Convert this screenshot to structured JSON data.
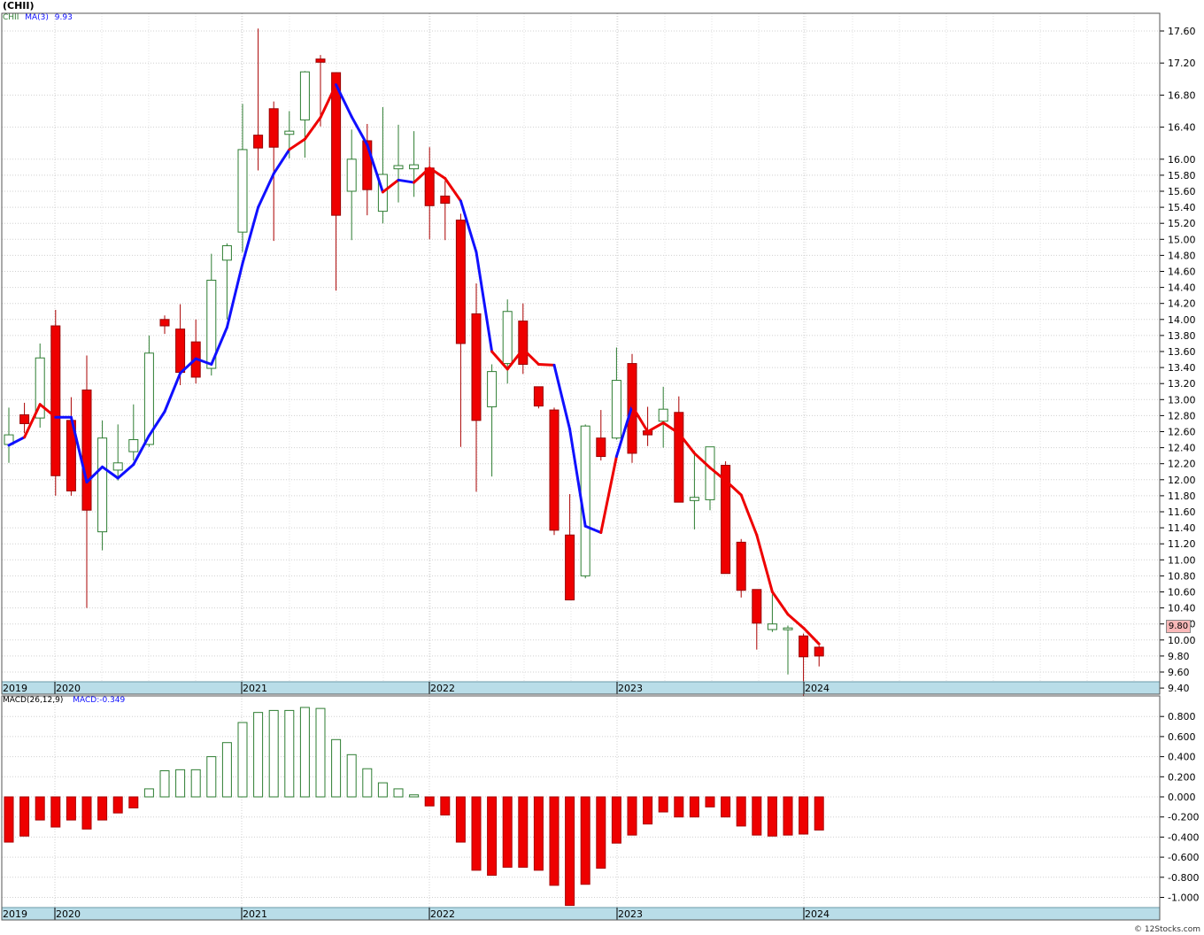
{
  "chart_data": [
    {
      "type": "candlestick",
      "title": "(CHII)",
      "legend": {
        "symbol": "CHII",
        "indicator": "MA(3)",
        "value": "9.93"
      },
      "y_ticks": [
        "17.60",
        "17.20",
        "16.80",
        "16.40",
        "16.00",
        "15.80",
        "15.60",
        "15.40",
        "15.20",
        "15.00",
        "14.80",
        "14.60",
        "14.40",
        "14.20",
        "14.00",
        "13.80",
        "13.60",
        "13.40",
        "13.20",
        "13.00",
        "12.80",
        "12.60",
        "12.40",
        "12.20",
        "12.00",
        "11.80",
        "11.60",
        "11.40",
        "11.20",
        "11.00",
        "10.80",
        "10.60",
        "10.40",
        "10.20",
        "10.00",
        "9.80",
        "9.60",
        "9.40"
      ],
      "last_price": "9.80",
      "x_labels": [
        "2019",
        "2020",
        "2021",
        "2022",
        "2023",
        "2024"
      ],
      "candles": [
        {
          "o": 12.44,
          "h": 12.9,
          "l": 12.21,
          "c": 12.56
        },
        {
          "o": 12.81,
          "h": 12.96,
          "l": 12.58,
          "c": 12.7
        },
        {
          "o": 12.77,
          "h": 13.7,
          "l": 12.65,
          "c": 13.52
        },
        {
          "o": 13.92,
          "h": 14.12,
          "l": 11.8,
          "c": 12.05
        },
        {
          "o": 12.74,
          "h": 13.03,
          "l": 11.8,
          "c": 11.86
        },
        {
          "o": 13.12,
          "h": 13.55,
          "l": 10.4,
          "c": 11.62
        },
        {
          "o": 11.35,
          "h": 12.74,
          "l": 11.12,
          "c": 12.52
        },
        {
          "o": 12.12,
          "h": 12.69,
          "l": 11.99,
          "c": 12.21
        },
        {
          "o": 12.35,
          "h": 12.94,
          "l": 12.24,
          "c": 12.5
        },
        {
          "o": 12.44,
          "h": 13.8,
          "l": 12.41,
          "c": 13.58
        },
        {
          "o": 14.0,
          "h": 14.05,
          "l": 13.82,
          "c": 13.92
        },
        {
          "o": 13.88,
          "h": 14.19,
          "l": 13.18,
          "c": 13.34
        },
        {
          "o": 13.72,
          "h": 14.0,
          "l": 13.2,
          "c": 13.28
        },
        {
          "o": 13.39,
          "h": 14.82,
          "l": 13.3,
          "c": 14.49
        },
        {
          "o": 14.74,
          "h": 14.95,
          "l": 14.0,
          "c": 14.92
        },
        {
          "o": 15.09,
          "h": 16.69,
          "l": 14.84,
          "c": 16.12
        },
        {
          "o": 16.3,
          "h": 17.63,
          "l": 15.86,
          "c": 16.14
        },
        {
          "o": 16.63,
          "h": 16.72,
          "l": 14.98,
          "c": 16.15
        },
        {
          "o": 16.31,
          "h": 16.6,
          "l": 16.01,
          "c": 16.35
        },
        {
          "o": 16.49,
          "h": 17.1,
          "l": 16.02,
          "c": 17.09
        },
        {
          "o": 17.25,
          "h": 17.3,
          "l": 16.41,
          "c": 17.21
        },
        {
          "o": 17.08,
          "h": 17.08,
          "l": 14.36,
          "c": 15.3
        },
        {
          "o": 15.6,
          "h": 16.37,
          "l": 14.99,
          "c": 16.0
        },
        {
          "o": 16.23,
          "h": 16.44,
          "l": 15.3,
          "c": 15.62
        },
        {
          "o": 15.35,
          "h": 16.65,
          "l": 15.2,
          "c": 15.81
        },
        {
          "o": 15.88,
          "h": 16.43,
          "l": 15.46,
          "c": 15.92
        },
        {
          "o": 15.88,
          "h": 16.35,
          "l": 15.53,
          "c": 15.93
        },
        {
          "o": 15.89,
          "h": 16.15,
          "l": 15.0,
          "c": 15.42
        },
        {
          "o": 15.54,
          "h": 15.73,
          "l": 14.99,
          "c": 15.45
        },
        {
          "o": 15.24,
          "h": 15.32,
          "l": 12.41,
          "c": 13.7
        },
        {
          "o": 14.07,
          "h": 14.45,
          "l": 11.85,
          "c": 12.74
        },
        {
          "o": 12.91,
          "h": 13.44,
          "l": 12.04,
          "c": 13.35
        },
        {
          "o": 13.45,
          "h": 14.25,
          "l": 13.2,
          "c": 14.1
        },
        {
          "o": 13.98,
          "h": 14.2,
          "l": 13.32,
          "c": 13.44
        },
        {
          "o": 13.16,
          "h": 13.16,
          "l": 12.89,
          "c": 12.92
        },
        {
          "o": 12.87,
          "h": 12.9,
          "l": 11.31,
          "c": 11.37
        },
        {
          "o": 11.31,
          "h": 11.82,
          "l": 10.5,
          "c": 10.5
        },
        {
          "o": 10.8,
          "h": 12.69,
          "l": 10.77,
          "c": 12.67
        },
        {
          "o": 12.52,
          "h": 12.87,
          "l": 12.24,
          "c": 12.29
        },
        {
          "o": 12.52,
          "h": 13.65,
          "l": 12.5,
          "c": 13.24
        },
        {
          "o": 13.45,
          "h": 13.57,
          "l": 12.21,
          "c": 12.33
        },
        {
          "o": 12.61,
          "h": 12.91,
          "l": 12.42,
          "c": 12.56
        },
        {
          "o": 12.73,
          "h": 13.16,
          "l": 12.4,
          "c": 12.88
        },
        {
          "o": 12.84,
          "h": 13.04,
          "l": 11.72,
          "c": 11.72
        },
        {
          "o": 11.74,
          "h": 12.36,
          "l": 11.38,
          "c": 11.78
        },
        {
          "o": 11.75,
          "h": 12.4,
          "l": 11.62,
          "c": 12.41
        },
        {
          "o": 12.18,
          "h": 12.23,
          "l": 10.83,
          "c": 10.83
        },
        {
          "o": 11.22,
          "h": 11.26,
          "l": 10.53,
          "c": 10.62
        },
        {
          "o": 10.63,
          "h": 10.56,
          "l": 9.88,
          "c": 10.21
        },
        {
          "o": 10.13,
          "h": 10.57,
          "l": 10.1,
          "c": 10.2
        },
        {
          "o": 10.15,
          "h": 10.18,
          "l": 9.57,
          "c": 10.15
        },
        {
          "o": 10.05,
          "h": 10.08,
          "l": 9.3,
          "c": 9.79
        },
        {
          "o": 9.91,
          "h": 9.93,
          "l": 9.67,
          "c": 9.8
        }
      ],
      "ma3": [
        12.43,
        12.53,
        12.94,
        12.78,
        12.78,
        11.97,
        12.16,
        12.02,
        12.19,
        12.55,
        12.85,
        13.33,
        13.51,
        13.44,
        13.9,
        14.7,
        15.4,
        15.82,
        16.12,
        16.25,
        16.52,
        16.93,
        16.53,
        16.18,
        15.59,
        15.74,
        15.71,
        15.89,
        15.76,
        15.48,
        14.84,
        13.6,
        13.38,
        13.63,
        13.44,
        13.43,
        12.63,
        11.42,
        11.34,
        12.29,
        12.92,
        12.6,
        12.71,
        12.58,
        12.33,
        12.15,
        11.99,
        11.81,
        11.31,
        10.6,
        10.32,
        10.15,
        9.95
      ],
      "ma3_colors": [
        "blue",
        "blue",
        "red",
        "red",
        "blue",
        "blue",
        "blue",
        "blue",
        "blue",
        "blue",
        "blue",
        "blue",
        "blue",
        "blue",
        "blue",
        "blue",
        "blue",
        "blue",
        "blue",
        "red",
        "red",
        "red",
        "blue",
        "blue",
        "blue",
        "red",
        "blue",
        "red",
        "red",
        "red",
        "blue",
        "blue",
        "red",
        "red",
        "red",
        "red",
        "blue",
        "blue",
        "blue",
        "red",
        "blue",
        "red",
        "red",
        "red",
        "red",
        "red",
        "red",
        "red",
        "red",
        "red",
        "red",
        "red",
        "red"
      ]
    },
    {
      "type": "bar",
      "title": "MACD(26,12,9)",
      "legend_value_label": "MACD:-0.349",
      "y_ticks": [
        "0.800",
        "0.600",
        "0.400",
        "0.200",
        "0.000",
        "-0.200",
        "-0.400",
        "-0.600",
        "-0.800",
        "-1.000"
      ],
      "x_labels": [
        "2019",
        "2020",
        "2021",
        "2022",
        "2023",
        "2024"
      ],
      "values": [
        -0.45,
        -0.39,
        -0.23,
        -0.3,
        -0.23,
        -0.32,
        -0.23,
        -0.16,
        -0.11,
        0.08,
        0.26,
        0.27,
        0.27,
        0.4,
        0.54,
        0.74,
        0.84,
        0.86,
        0.86,
        0.89,
        0.88,
        0.57,
        0.42,
        0.28,
        0.14,
        0.08,
        0.02,
        -0.09,
        -0.18,
        -0.45,
        -0.73,
        -0.78,
        -0.7,
        -0.7,
        -0.73,
        -0.88,
        -1.08,
        -0.87,
        -0.71,
        -0.46,
        -0.38,
        -0.27,
        -0.15,
        -0.2,
        -0.2,
        -0.1,
        -0.2,
        -0.29,
        -0.38,
        -0.39,
        -0.38,
        -0.37,
        -0.33
      ]
    }
  ],
  "watermark": "© 12Stocks.com",
  "colors": {
    "up": "#2e7d32",
    "down": "#ee0000",
    "ma_blue": "#1010ff",
    "ma_red": "#ee0000",
    "axis_band": "#b9dde8",
    "grid": "#d0d0d0"
  }
}
